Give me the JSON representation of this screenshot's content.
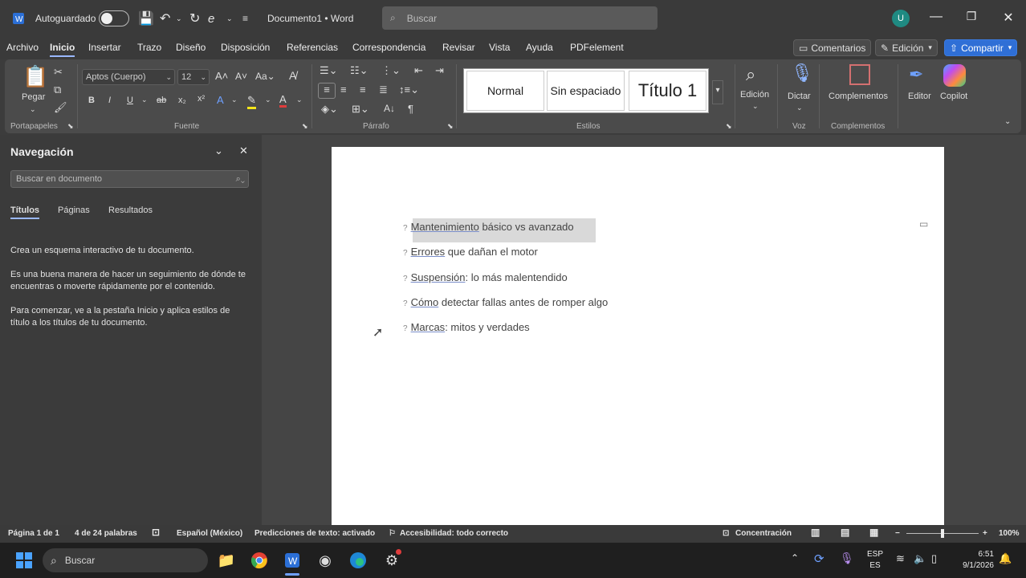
{
  "titlebar": {
    "autosave_label": "Autoguardado",
    "doc_title": "Documento1 • Word",
    "search_placeholder": "Buscar",
    "user_initial": "U"
  },
  "menu": {
    "items": [
      "Archivo",
      "Inicio",
      "Insertar",
      "Trazo",
      "Diseño",
      "Disposición",
      "Referencias",
      "Correspondencia",
      "Revisar",
      "Vista",
      "Ayuda",
      "PDFelement"
    ],
    "active": "Inicio",
    "comments_label": "Comentarios",
    "editing_label": "Edición",
    "share_label": "Compartir"
  },
  "ribbon": {
    "paste_label": "Pegar",
    "font_name": "Aptos (Cuerpo)",
    "font_size": "12",
    "styles": [
      "Normal",
      "Sin espaciado",
      "Título 1"
    ],
    "edition_label": "Edición",
    "dictate_label": "Dictar",
    "addins_label": "Complementos",
    "editor_label": "Editor",
    "copilot_label": "Copilot",
    "groups": [
      "Portapapeles",
      "Fuente",
      "Párrafo",
      "Estilos",
      "Voz",
      "Complementos"
    ]
  },
  "navigation": {
    "title": "Navegación",
    "search_placeholder": "Buscar en documento",
    "tabs": [
      "Títulos",
      "Páginas",
      "Resultados"
    ],
    "active_tab": "Títulos",
    "p1": "Crea un esquema interactivo de tu documento.",
    "p2": "Es una buena manera de hacer un seguimiento de dónde te encuentras o moverte rápidamente por el contenido.",
    "p3": "Para comenzar, ve a la pestaña Inicio y aplica estilos de título a los títulos de tu documento."
  },
  "document": {
    "lines": [
      {
        "marker": "?",
        "underlined": "Mantenimiento",
        "rest": " básico vs avanzado"
      },
      {
        "marker": "?",
        "underlined": "Errores",
        "rest": " que dañan el motor"
      },
      {
        "marker": "?",
        "underlined": "Suspensión",
        "rest": ": lo más malentendido"
      },
      {
        "marker": "?",
        "underlined": "Cómo",
        "rest": " detectar fallas antes de romper algo"
      },
      {
        "marker": "?",
        "underlined": "Marcas",
        "rest": ": mitos y verdades"
      }
    ]
  },
  "statusbar": {
    "page": "Página 1 de 1",
    "words": "4 de 24 palabras",
    "language": "Español (México)",
    "predictions": "Predicciones de texto: activado",
    "accessibility": "Accesibilidad: todo correcto",
    "focus": "Concentración",
    "zoom": "100%"
  },
  "taskbar": {
    "search_label": "Buscar",
    "lang_top": "ESP",
    "lang_bottom": "ES",
    "time": "6:51",
    "date": "9/1/2026"
  }
}
